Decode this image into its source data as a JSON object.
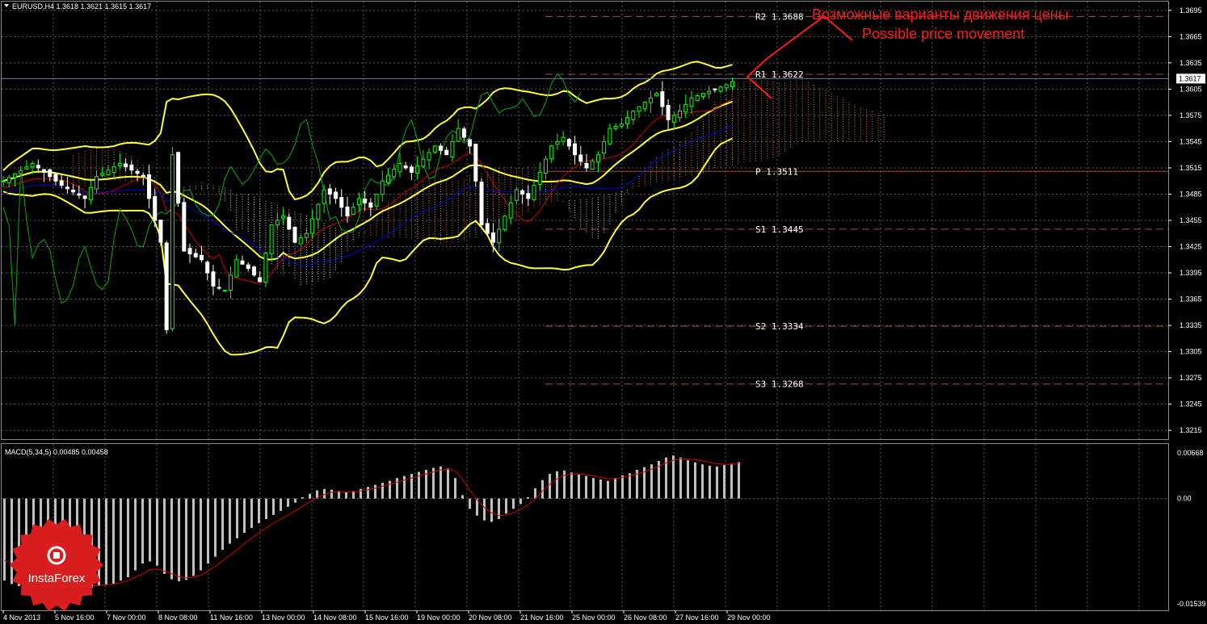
{
  "window": {
    "symbol_header": "EURUSD,H4  1.3618 1.3621 1.3615 1.3617",
    "macd_header": "MACD(5,34,5) 0.00485 0.00458"
  },
  "price_axis": {
    "ticks": [
      "1.3695",
      "1.3665",
      "1.3635",
      "1.3605",
      "1.3575",
      "1.3545",
      "1.3515",
      "1.3485",
      "1.3455",
      "1.3425",
      "1.3395",
      "1.3365",
      "1.3335",
      "1.3305",
      "1.3275",
      "1.3245",
      "1.3215"
    ],
    "current_price": "1.3617"
  },
  "macd_axis": {
    "ticks": [
      "0.00668",
      "0.00",
      "-0.01539"
    ]
  },
  "time_axis": {
    "labels": [
      "4 Nov 2013",
      "5 Nov 16:00",
      "7 Nov 00:00",
      "8 Nov 08:00",
      "11 Nov 16:00",
      "13 Nov 00:00",
      "14 Nov 08:00",
      "15 Nov 16:00",
      "19 Nov 00:00",
      "20 Nov 08:00",
      "21 Nov 16:00",
      "25 Nov 00:00",
      "26 Nov 08:00",
      "27 Nov 16:00",
      "29 Nov 00:00"
    ]
  },
  "pivots": [
    {
      "name": "R2",
      "label": "R2  1.3688",
      "value": 1.3688
    },
    {
      "name": "R1",
      "label": "R1  1.3622",
      "value": 1.3622
    },
    {
      "name": "P",
      "label": "P  1.3511",
      "value": 1.3511
    },
    {
      "name": "S1",
      "label": "S1  1.3445",
      "value": 1.3445
    },
    {
      "name": "S2",
      "label": "S2  1.3334",
      "value": 1.3334
    },
    {
      "name": "S3",
      "label": "S3  1.3268",
      "value": 1.3268
    }
  ],
  "annotation": {
    "line1": "Возможные варианты движения цены",
    "line2": "Possible price movement"
  },
  "logo": {
    "text": "InstaForex"
  },
  "colors": {
    "background": "#000000",
    "grid": "#5a5a5a",
    "bull_candle": "#00ff00",
    "bear_candle": "#ffffff",
    "bollinger": "#ffff33",
    "tenkan": "#cc0000",
    "kijun": "#0000cc",
    "chikou": "#00aa00",
    "kumo_up": "#ff9933",
    "kumo_down": "#ffffff",
    "pivot_line": "#a05030",
    "annotation": "#ff1a1a",
    "macd_hist": "#c0c0c0",
    "macd_signal": "#cc0000",
    "price_line": "#6b7b9b",
    "logo": "#d81e1e"
  },
  "chart_data": {
    "type": "candlestick",
    "symbol": "EURUSD",
    "timeframe": "H4",
    "price_range": [
      1.3205,
      1.3705
    ],
    "macd_range": [
      -0.01539,
      0.00668
    ],
    "price_path": [
      [
        0,
        1.35
      ],
      [
        5,
        1.352
      ],
      [
        10,
        1.3495
      ],
      [
        14,
        1.348
      ],
      [
        16,
        1.3505
      ],
      [
        20,
        1.352
      ],
      [
        24,
        1.3505
      ],
      [
        27,
        1.343
      ],
      [
        28,
        1.333
      ],
      [
        29,
        1.353
      ],
      [
        31,
        1.342
      ],
      [
        34,
        1.341
      ],
      [
        36,
        1.338
      ],
      [
        38,
        1.3375
      ],
      [
        40,
        1.341
      ],
      [
        42,
        1.34
      ],
      [
        44,
        1.3385
      ],
      [
        46,
        1.345
      ],
      [
        48,
        1.346
      ],
      [
        50,
        1.343
      ],
      [
        52,
        1.344
      ],
      [
        55,
        1.349
      ],
      [
        57,
        1.348
      ],
      [
        59,
        1.346
      ],
      [
        61,
        1.348
      ],
      [
        63,
        1.347
      ],
      [
        65,
        1.35
      ],
      [
        68,
        1.352
      ],
      [
        70,
        1.351
      ],
      [
        72,
        1.3525
      ],
      [
        74,
        1.354
      ],
      [
        76,
        1.353
      ],
      [
        78,
        1.356
      ],
      [
        80,
        1.354
      ],
      [
        81,
        1.35
      ],
      [
        82,
        1.345
      ],
      [
        84,
        1.343
      ],
      [
        86,
        1.346
      ],
      [
        88,
        1.349
      ],
      [
        90,
        1.348
      ],
      [
        92,
        1.351
      ],
      [
        94,
        1.354
      ],
      [
        96,
        1.355
      ],
      [
        98,
        1.353
      ],
      [
        100,
        1.3515
      ],
      [
        102,
        1.353
      ],
      [
        104,
        1.356
      ],
      [
        106,
        1.3565
      ],
      [
        108,
        1.358
      ],
      [
        110,
        1.359
      ],
      [
        112,
        1.36
      ],
      [
        114,
        1.357
      ],
      [
        116,
        1.358
      ],
      [
        118,
        1.3595
      ],
      [
        120,
        1.36
      ],
      [
        122,
        1.3605
      ],
      [
        124,
        1.361
      ],
      [
        126,
        1.3617
      ]
    ],
    "macd": {
      "histogram": [
        -0.012,
        -0.0125,
        -0.0128,
        -0.013,
        -0.0131,
        -0.013,
        -0.0128,
        -0.0125,
        -0.0128,
        -0.0131,
        -0.0133,
        -0.0132,
        -0.013,
        -0.0128,
        -0.0126,
        -0.0125,
        -0.012,
        -0.0115,
        -0.0105,
        -0.0095,
        -0.0092,
        -0.0098,
        -0.011,
        -0.0118,
        -0.0121,
        -0.0119,
        -0.0113,
        -0.0105,
        -0.0095,
        -0.0085,
        -0.0075,
        -0.0066,
        -0.0058,
        -0.005,
        -0.0043,
        -0.0036,
        -0.003,
        -0.0024,
        -0.0018,
        -0.0012,
        -0.0006,
        0.0002,
        0.0007,
        0.0012,
        0.0014,
        0.0013,
        0.0011,
        0.0009,
        0.0011,
        0.0014,
        0.0017,
        0.002,
        0.0023,
        0.0026,
        0.003,
        0.0033,
        0.0036,
        0.0039,
        0.0042,
        0.0045,
        0.0047,
        0.0044,
        0.003,
        0.0005,
        -0.0015,
        -0.0025,
        -0.0032,
        -0.0034,
        -0.003,
        -0.0022,
        -0.0015,
        -0.0008,
        0.0002,
        0.0015,
        0.0027,
        0.0036,
        0.004,
        0.0041,
        0.0038,
        0.0035,
        0.0033,
        0.003,
        0.0028,
        0.0026,
        0.003,
        0.0034,
        0.0037,
        0.0042,
        0.0046,
        0.005,
        0.0055,
        0.006,
        0.0063,
        0.006,
        0.0056,
        0.0053,
        0.005,
        0.0048,
        0.0047,
        0.0049,
        0.0051,
        0.0053
      ],
      "signal": [
        -0.009,
        -0.0095,
        -0.01,
        -0.0106,
        -0.0112,
        -0.0116,
        -0.012,
        -0.0122,
        -0.0123,
        -0.0125,
        -0.0127,
        -0.0128,
        -0.0128,
        -0.0127,
        -0.0126,
        -0.0125,
        -0.0123,
        -0.012,
        -0.0115,
        -0.011,
        -0.0104,
        -0.0103,
        -0.0106,
        -0.011,
        -0.0114,
        -0.0116,
        -0.0115,
        -0.0112,
        -0.0106,
        -0.0099,
        -0.0091,
        -0.0083,
        -0.0075,
        -0.0066,
        -0.0058,
        -0.005,
        -0.0043,
        -0.0036,
        -0.003,
        -0.0024,
        -0.0018,
        -0.0011,
        -0.0005,
        0.0001,
        0.0006,
        0.0009,
        0.001,
        0.001,
        0.001,
        0.0011,
        0.0013,
        0.0015,
        0.0018,
        0.0021,
        0.0024,
        0.0027,
        0.003,
        0.0033,
        0.0036,
        0.0039,
        0.0042,
        0.0043,
        0.004,
        0.0028,
        0.0012,
        -0.0002,
        -0.0013,
        -0.0021,
        -0.0025,
        -0.0024,
        -0.0021,
        -0.0016,
        -0.0009,
        0.0,
        0.0011,
        0.0021,
        0.0029,
        0.0034,
        0.0036,
        0.0036,
        0.0035,
        0.0033,
        0.0031,
        0.0029,
        0.0029,
        0.0031,
        0.0033,
        0.0036,
        0.0039,
        0.0043,
        0.0047,
        0.0052,
        0.0056,
        0.0058,
        0.0058,
        0.0057,
        0.0055,
        0.0053,
        0.0051,
        0.005,
        0.005,
        0.0051
      ]
    }
  }
}
